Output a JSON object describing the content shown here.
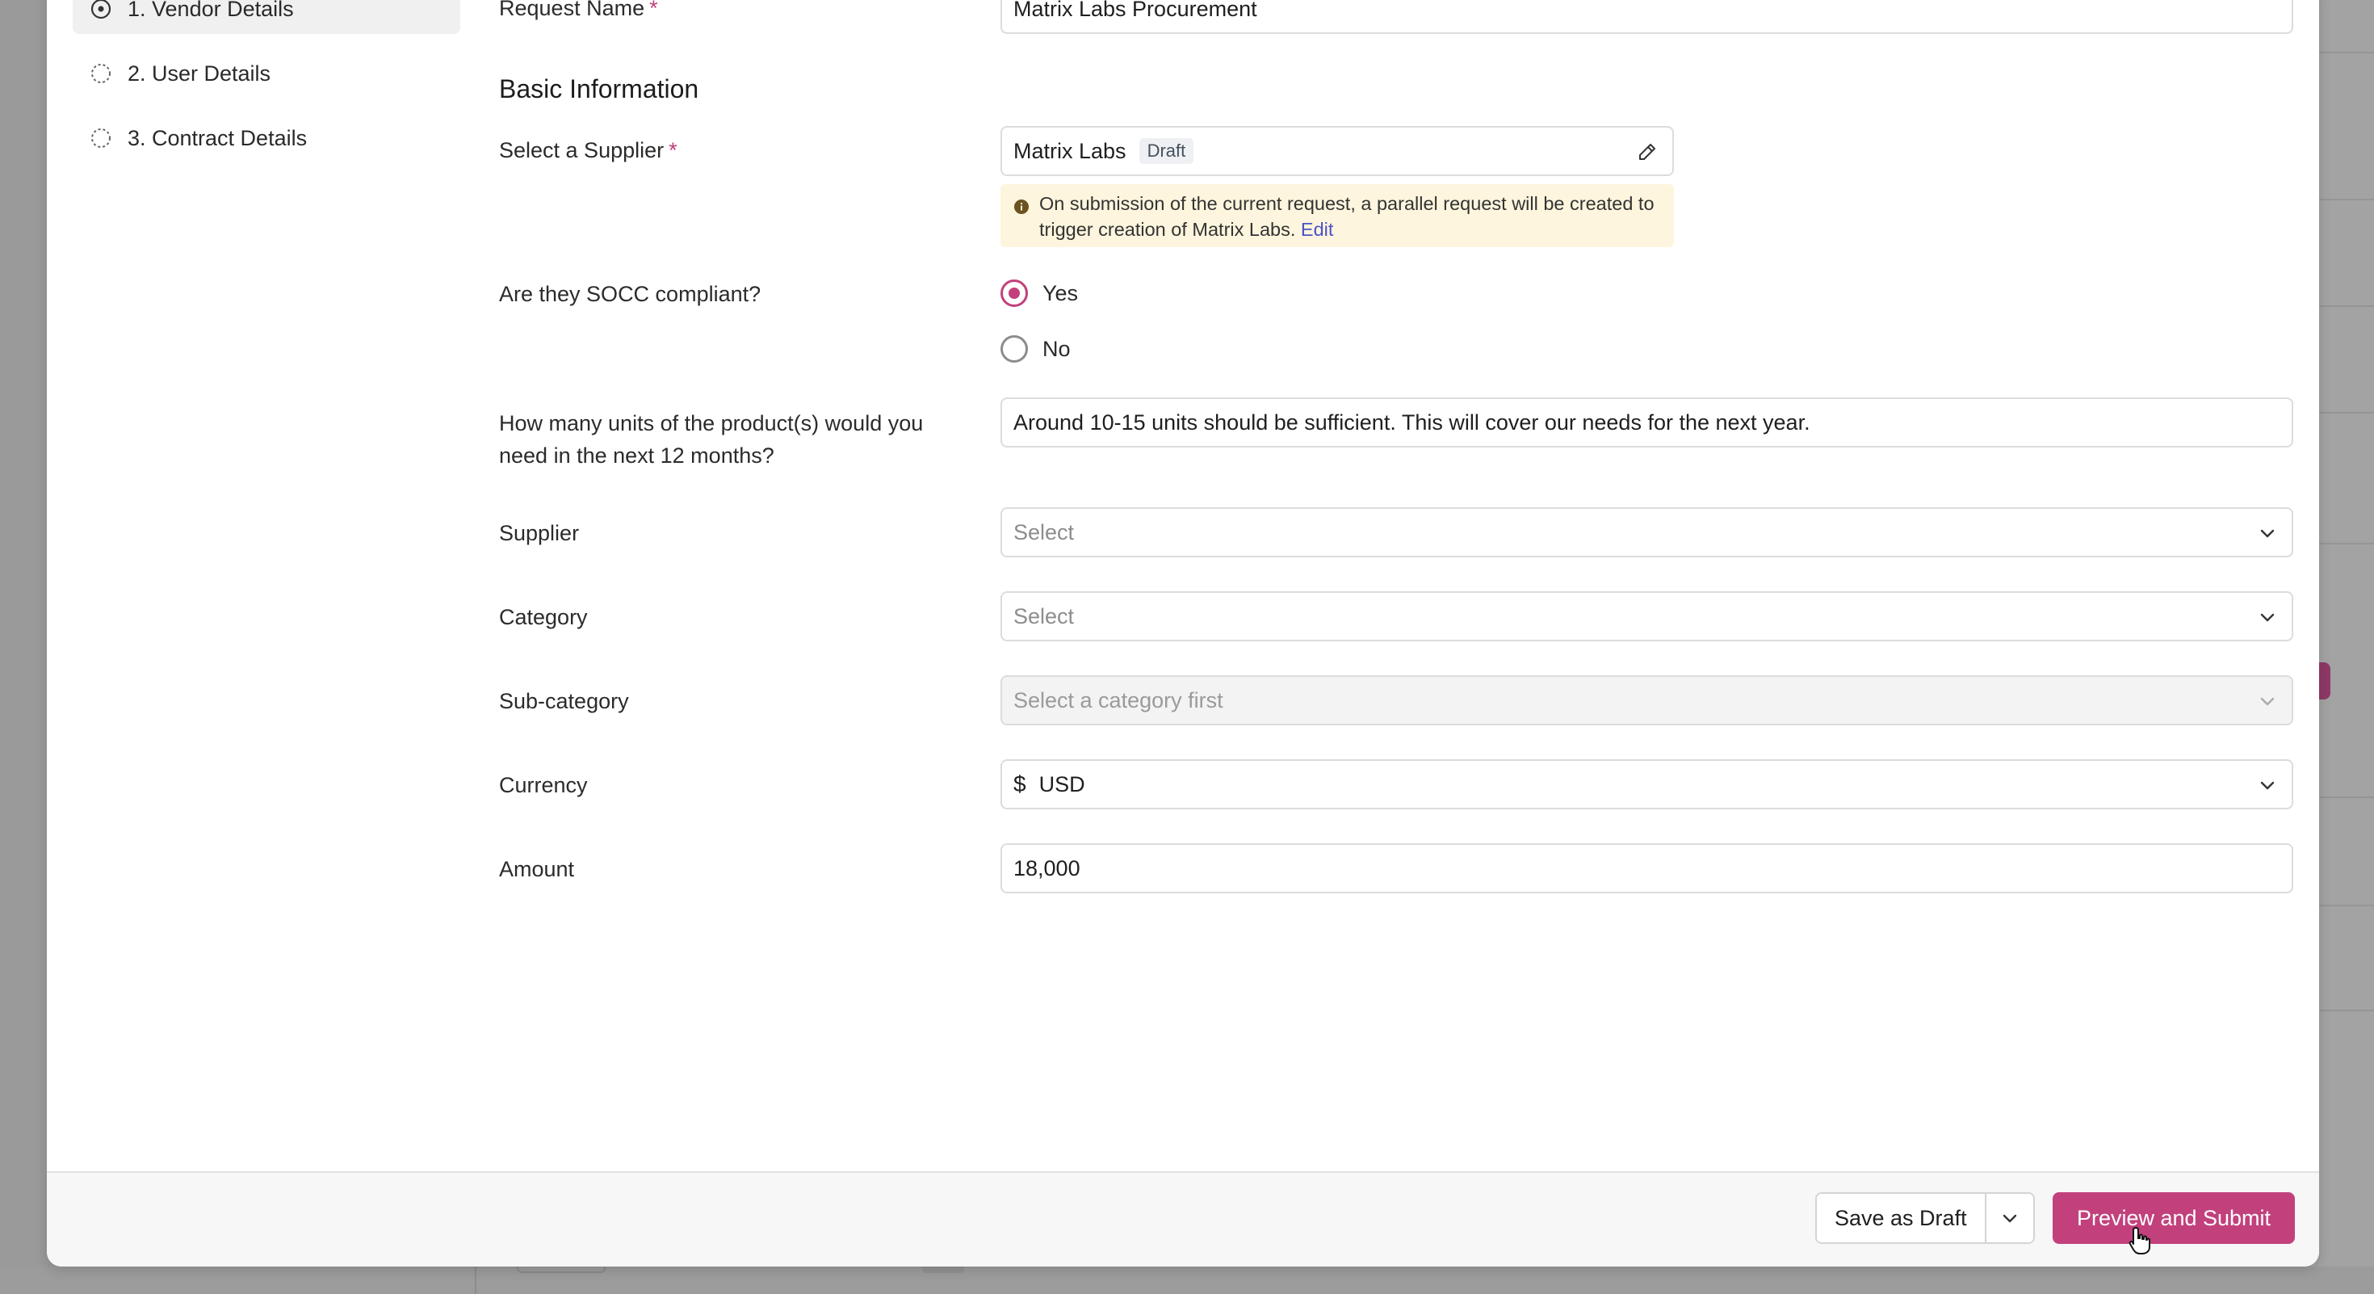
{
  "sidebar": {
    "steps": [
      {
        "label": "1. Vendor Details",
        "state": "active"
      },
      {
        "label": "2. User Details",
        "state": "pending"
      },
      {
        "label": "3. Contract Details",
        "state": "pending"
      }
    ]
  },
  "form": {
    "request_name": {
      "label": "Request Name",
      "value": "Matrix Labs Procurement"
    },
    "section_title": "Basic Information",
    "supplier_select": {
      "label": "Select a Supplier",
      "value": "Matrix Labs",
      "badge": "Draft",
      "notice_text": "On submission of the current request, a parallel request will be created to trigger creation of Matrix Labs.",
      "notice_link": "Edit"
    },
    "socc": {
      "label": "Are they SOCC compliant?",
      "options": [
        {
          "label": "Yes",
          "selected": true
        },
        {
          "label": "No",
          "selected": false
        }
      ]
    },
    "units": {
      "label": "How many units of the product(s) would you need in the next 12 months?",
      "value": "Around 10-15 units should be sufficient. This will cover our needs for the next year."
    },
    "supplier": {
      "label": "Supplier",
      "placeholder": "Select"
    },
    "category": {
      "label": "Category",
      "placeholder": "Select"
    },
    "subcategory": {
      "label": "Sub-category",
      "placeholder": "Select a category first"
    },
    "currency": {
      "label": "Currency",
      "symbol": "$",
      "value": "USD"
    },
    "amount": {
      "label": "Amount",
      "value": "18,000"
    }
  },
  "footer": {
    "save_draft_label": "Save as Draft",
    "submit_label": "Preview and Submit"
  },
  "colors": {
    "accent": "#c2417d",
    "notice_bg": "#fdf5dd",
    "link": "#4b53c8"
  }
}
